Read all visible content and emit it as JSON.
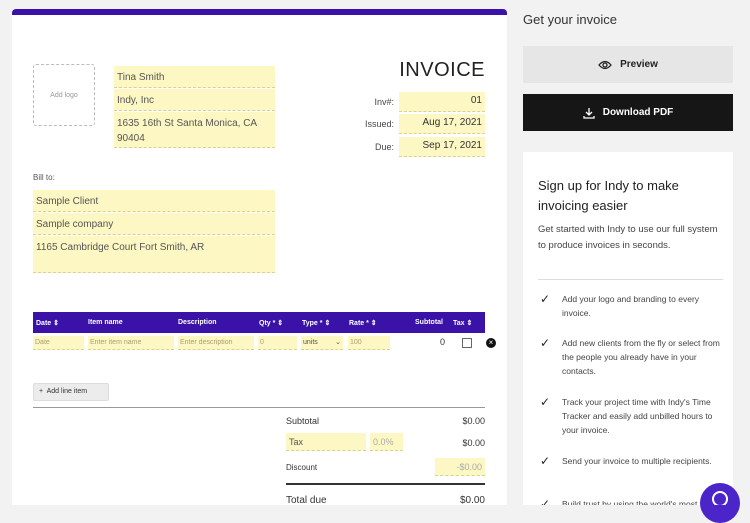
{
  "invoice": {
    "add_logo": "Add logo",
    "title": "INVOICE",
    "from": {
      "name": "Tina Smith",
      "company": "Indy, Inc",
      "address": "1635 16th St Santa Monica, CA 90404"
    },
    "meta": [
      {
        "label": "Inv#:",
        "value": "01"
      },
      {
        "label": "Issued:",
        "value": "Aug 17, 2021"
      },
      {
        "label": "Due:",
        "value": "Sep 17, 2021"
      }
    ],
    "bill_to_label": "Bill to:",
    "bill_to": {
      "client": "Sample Client",
      "company": "Sample company",
      "address": "1165  Cambridge Court Fort Smith, AR"
    },
    "columns": [
      "Date",
      "Item name",
      "Description",
      "Qty",
      "Type",
      "Rate",
      "Subtotal",
      "Tax"
    ],
    "line_item": {
      "date": "Date",
      "item": "Enter item name",
      "desc": "Enter description",
      "qty": "0",
      "type": "units",
      "rate": "100",
      "subtotal": "0"
    },
    "add_line": "Add line item",
    "totals": {
      "subtotal_label": "Subtotal",
      "subtotal": "$0.00",
      "tax_label": "Tax",
      "tax_rate": "0.0%",
      "tax": "$0.00",
      "discount_label": "Discount",
      "discount": "-$0.00",
      "total_label": "Total due",
      "total": "$0.00"
    }
  },
  "sidebar": {
    "title": "Get your invoice",
    "preview": "Preview",
    "download": "Download PDF",
    "promo_title": "Sign up for Indy to make invoicing easier",
    "promo_desc": "Get started with Indy to use our full system to produce invoices in seconds.",
    "bullets": [
      "Add your logo and branding to every invoice.",
      "Add new clients from the fly or select from the people you already have in your contacts.",
      "Track your project time with Indy's Time Tracker and easily add unbilled hours to your invoice.",
      "Send your invoice to multiple recipients.",
      "Build trust by using the world's most"
    ]
  },
  "colors": {
    "accent": "#3a12a8",
    "highlight": "#fdf7c3"
  }
}
